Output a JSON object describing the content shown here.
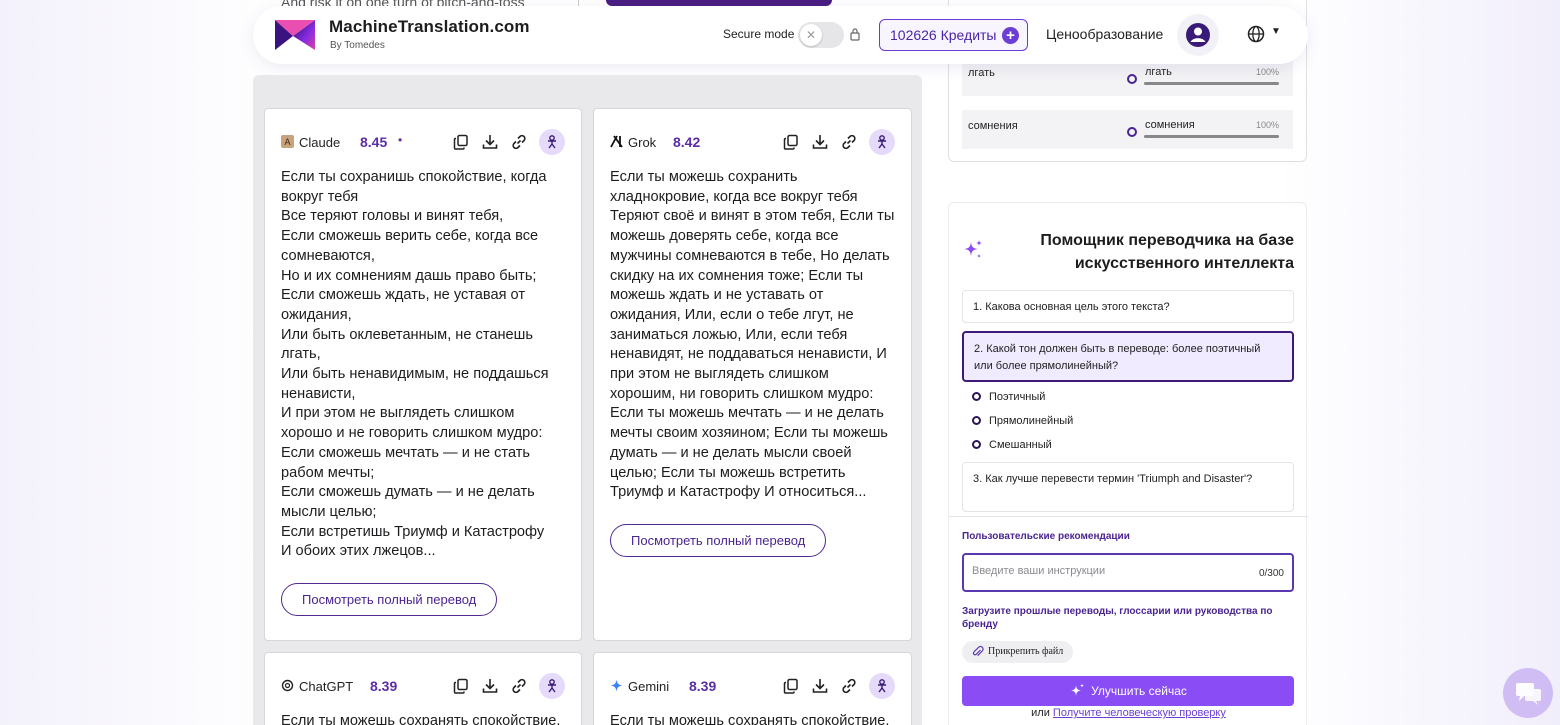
{
  "header": {
    "brand_name": "MachineTranslation.com",
    "brand_by": "By Tomedes",
    "secure_mode_label": "Secure mode",
    "credits_label": "102626 Кредиты",
    "pricing_label": "Ценообразование",
    "behind_text": "And risk it on one turn of pitch-and-toss"
  },
  "colors": {
    "accent": "#6b3fd4",
    "accent_dark": "#4a2592",
    "score": "#5b2ea6",
    "improve_button": "#8a4cf5"
  },
  "translations": [
    {
      "model": "Claude",
      "icon": "claude-icon",
      "score": "8.45",
      "marker": "•",
      "text": "Если ты сохранишь спокойствие, когда вокруг тебя\nВсе теряют головы и винят тебя,\nЕсли сможешь верить себе, когда все сомневаются,\nНо и их сомнениям дашь право быть;\nЕсли сможешь ждать, не уставая от ожидания,\nИли быть оклеветанным, не станешь лгать,\nИли быть ненавидимым, не поддашься ненависти,\nИ при этом не выглядеть слишком хорошо и не говорить слишком мудро:\nЕсли сможешь мечтать — и не стать рабом мечты;\nЕсли сможешь думать — и не делать мысли целью;\nЕсли встретишь Триумф и Катастрофу\nИ обоих этих лжецов...",
      "button": "Посмотреть полный перевод"
    },
    {
      "model": "Grok",
      "icon": "grok-icon",
      "score": "8.42",
      "text": "Если ты можешь сохранить хладнокровие, когда все вокруг тебя Теряют своё и винят в этом тебя, Если ты можешь доверять себе, когда все мужчины сомневаются в тебе, Но делать скидку на их сомнения тоже; Если ты можешь ждать и не уставать от ожидания, Или, если о тебе лгут, не заниматься ложью, Или, если тебя ненавидят, не поддаваться ненависти, И при этом не выглядеть слишком хорошим, ни говорить слишком мудро: Если ты можешь мечтать — и не делать мечты своим хозяином; Если ты можешь думать — и не делать мысли своей целью; Если ты можешь встретить Триумф и Катастрофу И относиться...",
      "button": "Посмотреть полный перевод"
    },
    {
      "model": "ChatGPT",
      "icon": "chatgpt-icon",
      "score": "8.39",
      "text": "Если ты можешь сохранять спокойствие,"
    },
    {
      "model": "Gemini",
      "icon": "gemini-icon",
      "score": "8.39",
      "text": "Если ты можешь сохранять спокойствие,"
    }
  ],
  "glossary": [
    {
      "source": "лгать",
      "target": "лгать",
      "percent": "100%",
      "level": 1.0
    },
    {
      "source": "сомнения",
      "target": "сомнения",
      "percent": "100%",
      "level": 1.0
    }
  ],
  "assistant": {
    "title": "Помощник переводчика на базе искусственного интеллекта",
    "q1": "1. Какова основная цель этого текста?",
    "q2": "2. Какой тон должен быть в переводе: более поэтичный или более прямолинейный?",
    "options": [
      "Поэтичный",
      "Прямолинейный",
      "Смешанный"
    ],
    "q3": "3. Как лучше перевести термин 'Triumph and Disaster'?",
    "recommendations_label": "Пользовательские рекомендации",
    "instructions_placeholder": "Введите ваши инструкции",
    "instructions_count": "0/300",
    "upload_label": "Загрузите прошлые переводы, глоссарии или руководства по бренду",
    "attach_label": "Прикрепить файл",
    "improve_label": "Улучшить сейчас",
    "or_label": "или",
    "human_review_label": "Получите человеческую проверку"
  }
}
